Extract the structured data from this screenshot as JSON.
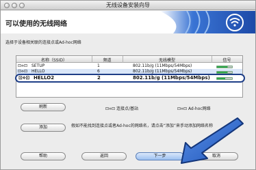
{
  "window": {
    "title": "无线设备安装向导"
  },
  "header": {
    "title": "可以使用的无线网络"
  },
  "subtitle": "选择于设备相关联的连接点或Ad-hoc网络",
  "table": {
    "columns": [
      "名称（SSID）",
      "频道",
      "无线模型",
      "信号"
    ],
    "rows": [
      {
        "ssid": "SETUP",
        "channel": "1",
        "mode": "802.11b/g (11Mbps/54Mbps)",
        "signal": "strong"
      },
      {
        "ssid": "HELLO",
        "channel": "6",
        "mode": "802.11b/g (11Mbps/54Mbps)",
        "signal": "strong"
      },
      {
        "ssid": "HELLO2",
        "channel": "2",
        "mode": "802.11b/g (11Mbps/54Mbps)",
        "signal": "medium"
      }
    ]
  },
  "legend": {
    "access_point": "连接点/基站",
    "adhoc": "Ad-hoc网络"
  },
  "hint": "假如不能找到连接点或者Ad-hoc的网络名，请点击“添加”来手动添加网络名称",
  "buttons": {
    "refresh": "刷新",
    "add": "添加",
    "help": "帮助",
    "back": "返回",
    "next": "下一步",
    "cancel": "取消"
  },
  "colors": {
    "accent": "#1d3d86",
    "highlight": "#2f6fd8",
    "signal": "#2fa84a"
  }
}
